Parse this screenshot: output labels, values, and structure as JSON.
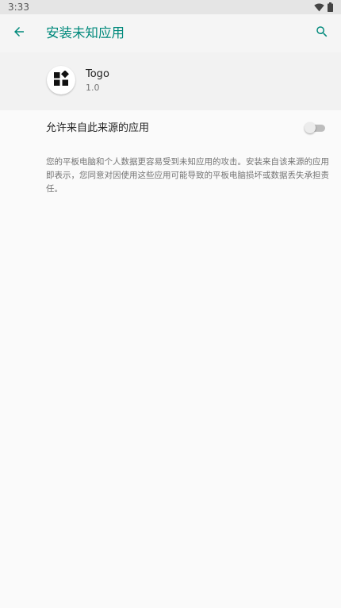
{
  "status_bar": {
    "time": "3:33",
    "icons": [
      "wifi-icon",
      "battery-icon"
    ]
  },
  "app_bar": {
    "title": "安装未知应用",
    "back_icon": "arrow-back-icon",
    "search_icon": "search-icon",
    "accent_color": "#00897b"
  },
  "app_info": {
    "name": "Togo",
    "version": "1.0",
    "icon": "widgets-icon"
  },
  "allow_setting": {
    "label": "允许来自此来源的应用",
    "enabled": false
  },
  "warning": {
    "text": "您的平板电脑和个人数据更容易受到未知应用的攻击。安装来自该来源的应用即表示，您同意对因使用这些应用可能导致的平板电脑损坏或数据丢失承担责任。"
  }
}
